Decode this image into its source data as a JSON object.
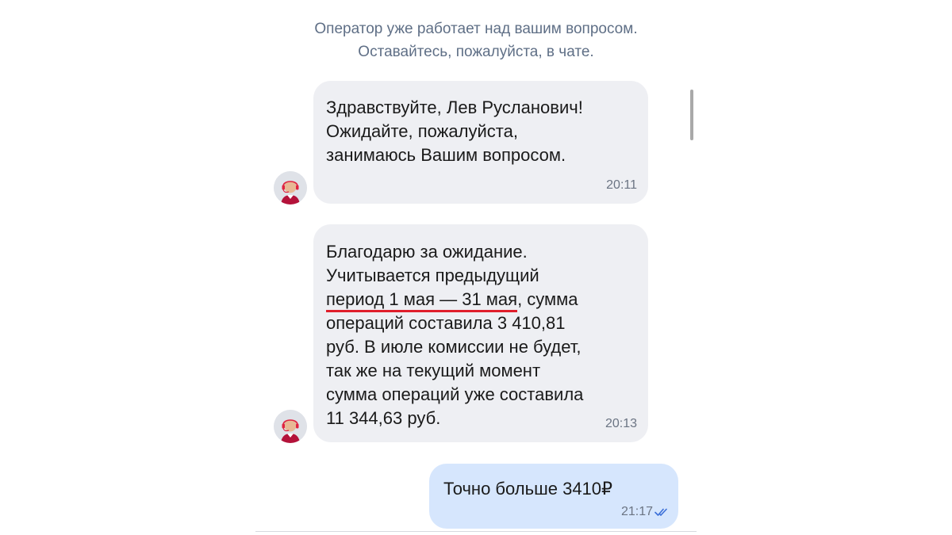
{
  "notice": {
    "line1": "Оператор уже работает над вашим вопросом.",
    "line2": "Оставайтесь, пожалуйста, в чате."
  },
  "messages": [
    {
      "direction": "incoming",
      "lines": [
        "Здравствуйте, Лев Русланович!",
        "Ожидайте, пожалуйста,",
        "занимаюсь Вашим вопросом."
      ],
      "time": "20:11"
    },
    {
      "direction": "incoming",
      "line1": "Благодарю за ожидание.",
      "line2": "Учитывается предыдущий",
      "line3_highlight": "период 1 мая — 31 мая",
      "line3_rest": ", сумма",
      "line4": "операций составила 3 410,81",
      "line5": "руб. В июле комиссии не будет,",
      "line6": "так же на текущий момент",
      "line7": "сумма операций уже составила",
      "line8": "11 344,63 руб.",
      "time": "20:13"
    },
    {
      "direction": "outgoing",
      "text": "Точно больше 3410₽",
      "time": "21:17",
      "status_icon": "double-check-icon",
      "status": "read"
    }
  ],
  "colors": {
    "incoming_bubble": "#eeeff3",
    "outgoing_bubble": "#d6e6fd",
    "notice_text": "#5f6f86",
    "read_check": "#3b6fd8",
    "highlight_underline": "#e01e2b"
  },
  "avatar_icon": "operator-headset-icon"
}
